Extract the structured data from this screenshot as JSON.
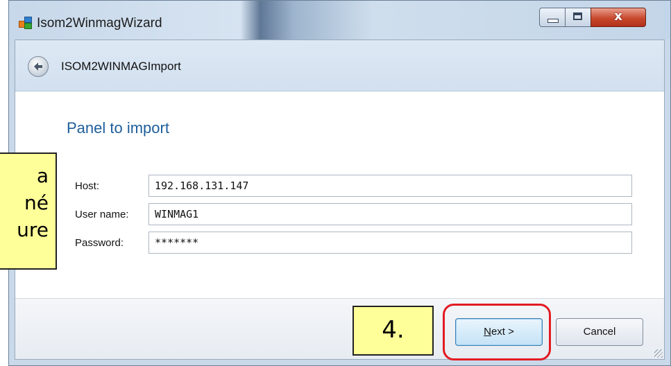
{
  "window": {
    "title": "Isom2WinmagWizard",
    "close_glyph": "x"
  },
  "wizard": {
    "page_name": "ISOM2WINMAGImport",
    "section_title": "Panel to import",
    "fields": [
      {
        "label": "Host:",
        "value": "192.168.131.147"
      },
      {
        "label": "User name:",
        "value": "WINMAG1"
      },
      {
        "label": "Password:",
        "value": "*******"
      }
    ]
  },
  "buttons": {
    "next_mnemonic": "N",
    "next_rest": "ext >",
    "cancel_label": "Cancel"
  },
  "annotations": {
    "left_callout_lines": [
      "a",
      "né",
      "ure"
    ],
    "step_label": "4."
  },
  "colors": {
    "accent_title": "#1e5e9b",
    "callout_fill": "#ffff99",
    "highlight_ring": "#e31b23",
    "close_button": "#c8492e"
  },
  "icons": {
    "app": "app-icon",
    "back": "back-arrow-icon",
    "minimize": "minimize-icon",
    "maximize": "maximize-icon",
    "close": "close-icon"
  }
}
